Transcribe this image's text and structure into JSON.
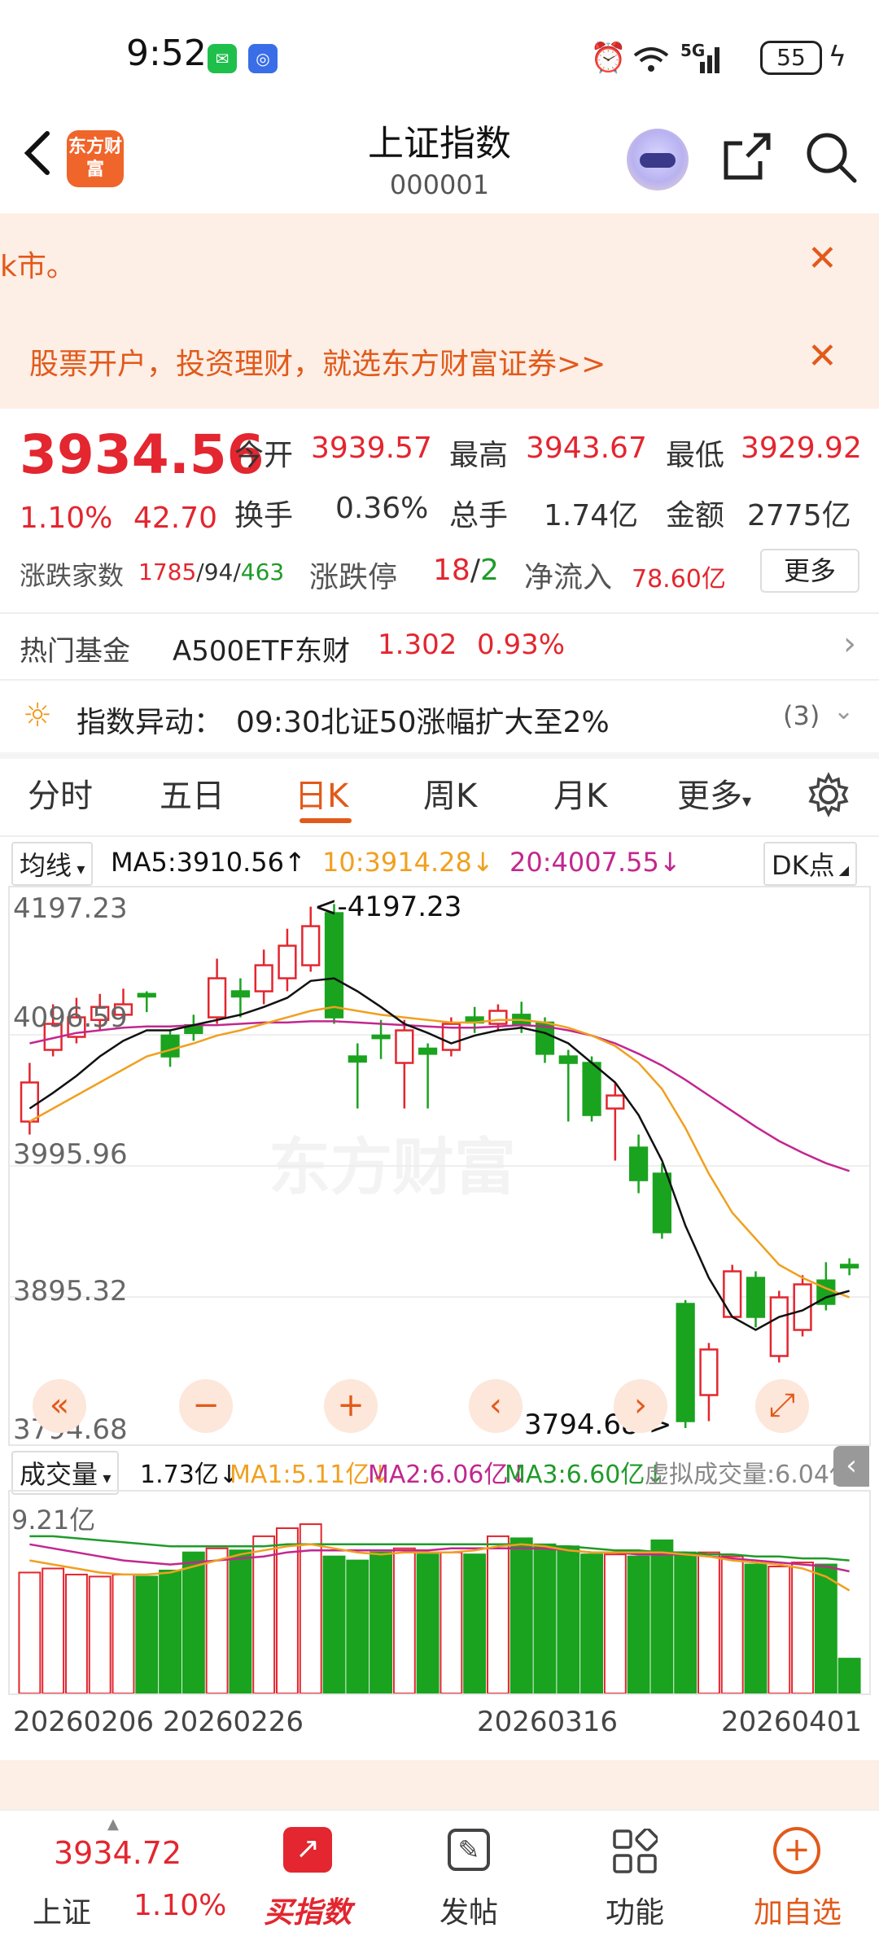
{
  "status": {
    "time": "9:52",
    "network": "5G",
    "battery": "55"
  },
  "header": {
    "title": "上证指数",
    "code": "000001",
    "logo_text": "东方财富"
  },
  "banners": [
    {
      "text": "k市。"
    },
    {
      "text": "股票开户，投资理财，就选东方财富证券>>"
    }
  ],
  "quote": {
    "price": "3934.56",
    "change_pct": "1.10%",
    "change": "42.70",
    "open_label": "今开",
    "open": "3939.57",
    "high_label": "最高",
    "high": "3943.67",
    "low_label": "最低",
    "low": "3929.92",
    "turnover_label": "换手",
    "turnover": "0.36%",
    "volume_label": "总手",
    "volume": "1.74亿",
    "amount_label": "金额",
    "amount": "2775亿",
    "breadth_label": "涨跌家数",
    "breadth_up": "1785",
    "breadth_flat": "94",
    "breadth_down": "463",
    "limit_label": "涨跌停",
    "limit_up": "18",
    "limit_down": "2",
    "netflow_label": "净流入",
    "netflow": "78.60亿",
    "more": "更多"
  },
  "fund": {
    "label": "热门基金",
    "name": "A500ETF东财",
    "price": "1.302",
    "pct": "0.93%"
  },
  "alert": {
    "label": "指数异动：",
    "text": "09:30北证50涨幅扩大至2%",
    "count": "(3)"
  },
  "tabs": [
    "分时",
    "五日",
    "日K",
    "周K",
    "月K",
    "更多"
  ],
  "active_tab": 2,
  "ma": {
    "selector": "均线",
    "ma5": "MA5:3910.56↑",
    "ma10": "10:3914.28↓",
    "ma20": "20:4007.55↓",
    "dk": "DK点"
  },
  "axis": {
    "y1": "4197.23",
    "y2": "4096.59",
    "y3": "3995.96",
    "y4": "3895.32",
    "y5": "3794.68",
    "max_mark": "<-4197.23",
    "min_mark": "3794.68->"
  },
  "vol": {
    "selector": "成交量",
    "v": "1.73亿↓",
    "ma1": "MA1:5.11亿↓",
    "ma2": "MA2:6.06亿↓",
    "ma3": "MA3:6.60亿↓",
    "virtual": "虚拟成交量:6.04亿",
    "ymax": "9.21亿"
  },
  "dates": [
    "20260206",
    "20260226",
    "20260316",
    "20260401"
  ],
  "watermark": "东方财富",
  "colors": {
    "up": "#e3262f",
    "down": "#1aa31f",
    "ma5": "#111111",
    "ma10": "#f0a020",
    "ma20": "#c2278f",
    "accent": "#e15a1a"
  },
  "chart_data": {
    "type": "candlestick",
    "ylim": [
      3794.68,
      4197.23
    ],
    "candles": [
      {
        "o": 4030,
        "c": 4060,
        "h": 4075,
        "l": 4020,
        "up": true
      },
      {
        "o": 4085,
        "c": 4105,
        "h": 4120,
        "l": 4080,
        "up": true
      },
      {
        "o": 4095,
        "c": 4110,
        "h": 4125,
        "l": 4090,
        "up": true
      },
      {
        "o": 4108,
        "c": 4118,
        "h": 4128,
        "l": 4100,
        "up": true
      },
      {
        "o": 4112,
        "c": 4120,
        "h": 4132,
        "l": 4108,
        "up": true
      },
      {
        "o": 4128,
        "c": 4126,
        "h": 4130,
        "l": 4114,
        "up": false
      },
      {
        "o": 4096,
        "c": 4080,
        "h": 4100,
        "l": 4072,
        "up": false
      },
      {
        "o": 4104,
        "c": 4098,
        "h": 4112,
        "l": 4092,
        "up": false
      },
      {
        "o": 4110,
        "c": 4140,
        "h": 4155,
        "l": 4105,
        "up": true
      },
      {
        "o": 4130,
        "c": 4126,
        "h": 4140,
        "l": 4110,
        "up": false
      },
      {
        "o": 4130,
        "c": 4150,
        "h": 4162,
        "l": 4120,
        "up": true
      },
      {
        "o": 4140,
        "c": 4165,
        "h": 4178,
        "l": 4130,
        "up": true
      },
      {
        "o": 4150,
        "c": 4180,
        "h": 4195,
        "l": 4145,
        "up": true
      },
      {
        "o": 4190,
        "c": 4110,
        "h": 4197,
        "l": 4105,
        "up": false
      },
      {
        "o": 4080,
        "c": 4076,
        "h": 4090,
        "l": 4040,
        "up": false
      },
      {
        "o": 4096,
        "c": 4094,
        "h": 4108,
        "l": 4078,
        "up": false
      },
      {
        "o": 4075,
        "c": 4100,
        "h": 4108,
        "l": 4040,
        "up": true
      },
      {
        "o": 4086,
        "c": 4082,
        "h": 4090,
        "l": 4040,
        "up": false
      },
      {
        "o": 4085,
        "c": 4105,
        "h": 4110,
        "l": 4080,
        "up": true
      },
      {
        "o": 4110,
        "c": 4106,
        "h": 4118,
        "l": 4098,
        "up": false
      },
      {
        "o": 4105,
        "c": 4115,
        "h": 4120,
        "l": 4100,
        "up": true
      },
      {
        "o": 4112,
        "c": 4104,
        "h": 4122,
        "l": 4098,
        "up": false
      },
      {
        "o": 4106,
        "c": 4082,
        "h": 4110,
        "l": 4075,
        "up": false
      },
      {
        "o": 4080,
        "c": 4075,
        "h": 4085,
        "l": 4030,
        "up": false
      },
      {
        "o": 4075,
        "c": 4035,
        "h": 4080,
        "l": 4030,
        "up": false
      },
      {
        "o": 4040,
        "c": 4050,
        "h": 4060,
        "l": 4000,
        "up": true
      },
      {
        "o": 4010,
        "c": 3985,
        "h": 4020,
        "l": 3975,
        "up": false
      },
      {
        "o": 3990,
        "c": 3945,
        "h": 3998,
        "l": 3940,
        "up": false
      },
      {
        "o": 3890,
        "c": 3800,
        "h": 3893,
        "l": 3794.68,
        "up": false
      },
      {
        "o": 3820,
        "c": 3855,
        "h": 3860,
        "l": 3800,
        "up": true
      },
      {
        "o": 3880,
        "c": 3915,
        "h": 3920,
        "l": 3880,
        "up": true
      },
      {
        "o": 3910,
        "c": 3880,
        "h": 3915,
        "l": 3872,
        "up": false
      },
      {
        "o": 3850,
        "c": 3895,
        "h": 3900,
        "l": 3845,
        "up": true
      },
      {
        "o": 3870,
        "c": 3905,
        "h": 3912,
        "l": 3865,
        "up": true
      },
      {
        "o": 3908,
        "c": 3890,
        "h": 3922,
        "l": 3885,
        "up": false
      },
      {
        "o": 3918,
        "c": 3920,
        "h": 3925,
        "l": 3912,
        "up": false
      }
    ],
    "ma5": [
      4040,
      4052,
      4065,
      4080,
      4092,
      4100,
      4100,
      4104,
      4108,
      4112,
      4118,
      4125,
      4138,
      4140,
      4130,
      4118,
      4105,
      4098,
      4090,
      4096,
      4100,
      4102,
      4098,
      4090,
      4075,
      4060,
      4035,
      4000,
      3950,
      3910,
      3880,
      3870,
      3880,
      3885,
      3895,
      3900
    ],
    "ma10": [
      4030,
      4040,
      4050,
      4060,
      4070,
      4080,
      4085,
      4090,
      4096,
      4100,
      4105,
      4110,
      4115,
      4118,
      4115,
      4112,
      4110,
      4108,
      4106,
      4106,
      4108,
      4108,
      4106,
      4102,
      4096,
      4088,
      4075,
      4055,
      4025,
      3990,
      3960,
      3940,
      3920,
      3910,
      3902,
      3895
    ],
    "ma20": [
      4090,
      4094,
      4098,
      4100,
      4102,
      4103,
      4103,
      4104,
      4104,
      4105,
      4106,
      4106,
      4107,
      4107,
      4106,
      4105,
      4104,
      4103,
      4102,
      4102,
      4103,
      4104,
      4103,
      4100,
      4096,
      4090,
      4082,
      4073,
      4062,
      4050,
      4038,
      4026,
      4015,
      4006,
      3998,
      3992
    ],
    "volumes": [
      6.0,
      6.2,
      5.9,
      5.8,
      5.9,
      5.8,
      6.1,
      7.0,
      7.2,
      7.1,
      7.8,
      8.2,
      8.4,
      6.8,
      6.6,
      7.0,
      7.2,
      6.9,
      7.0,
      6.9,
      7.8,
      7.7,
      7.4,
      7.3,
      6.9,
      6.9,
      6.8,
      7.6,
      7.0,
      7.0,
      6.8,
      6.4,
      6.3,
      6.5,
      6.4,
      1.73
    ],
    "vol_ma1": [
      6.6,
      6.4,
      6.2,
      6.0,
      5.9,
      5.9,
      6.0,
      6.3,
      6.6,
      6.9,
      7.1,
      7.3,
      7.4,
      7.2,
      7.0,
      6.9,
      7.0,
      7.0,
      7.0,
      7.1,
      7.3,
      7.4,
      7.3,
      7.1,
      7.0,
      7.0,
      7.0,
      7.0,
      6.9,
      6.8,
      6.6,
      6.5,
      6.4,
      6.2,
      5.8,
      5.11
    ],
    "vol_ma2": [
      7.4,
      7.2,
      7.0,
      6.8,
      6.6,
      6.5,
      6.4,
      6.5,
      6.6,
      6.7,
      6.8,
      7.0,
      7.1,
      7.1,
      7.1,
      7.1,
      7.1,
      7.1,
      7.2,
      7.2,
      7.2,
      7.2,
      7.2,
      7.1,
      7.0,
      7.0,
      6.9,
      6.9,
      6.9,
      6.8,
      6.7,
      6.6,
      6.5,
      6.4,
      6.3,
      6.06
    ],
    "vol_ma3": [
      7.8,
      7.8,
      7.7,
      7.6,
      7.5,
      7.4,
      7.3,
      7.3,
      7.3,
      7.3,
      7.3,
      7.4,
      7.4,
      7.4,
      7.4,
      7.4,
      7.4,
      7.4,
      7.4,
      7.4,
      7.4,
      7.4,
      7.3,
      7.3,
      7.2,
      7.1,
      7.1,
      7.0,
      7.0,
      6.9,
      6.9,
      6.8,
      6.8,
      6.7,
      6.7,
      6.6
    ],
    "vol_max": 9.21
  },
  "bottom_nav": {
    "index_price": "3934.72",
    "index_name": "上证",
    "index_pct": "1.10%",
    "items": [
      "买指数",
      "发帖",
      "功能",
      "加自选"
    ]
  }
}
